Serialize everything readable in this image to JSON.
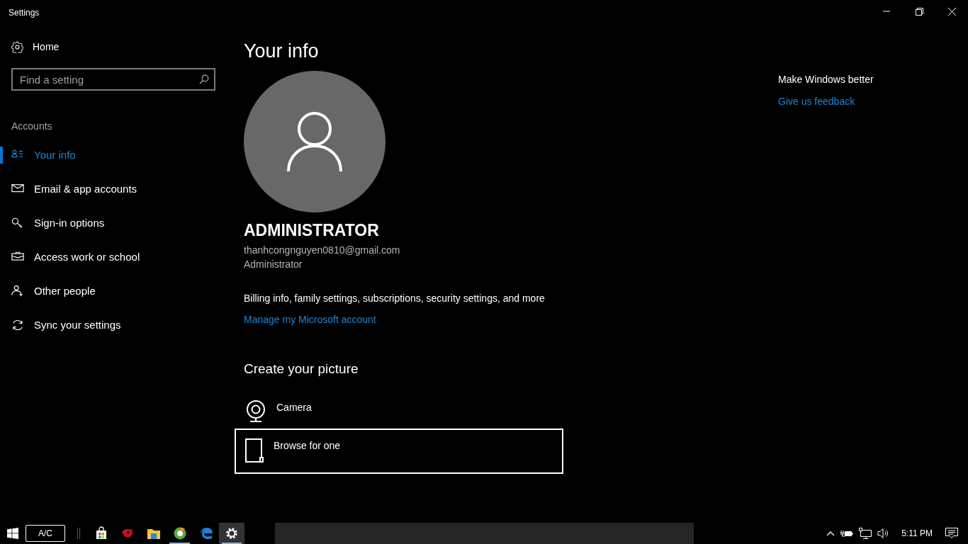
{
  "window": {
    "title": "Settings"
  },
  "sidebar": {
    "home": "Home",
    "search": {
      "placeholder": "Find a setting"
    },
    "section": "Accounts",
    "items": [
      {
        "label": "Your info",
        "selected": true
      },
      {
        "label": "Email & app accounts",
        "selected": false
      },
      {
        "label": "Sign-in options",
        "selected": false
      },
      {
        "label": "Access work or school",
        "selected": false
      },
      {
        "label": "Other people",
        "selected": false
      },
      {
        "label": "Sync your settings",
        "selected": false
      }
    ]
  },
  "main": {
    "title": "Your info",
    "name": "ADMINISTRATOR",
    "email": "thanhcongnguyen0810@gmail.com",
    "role": "Administrator",
    "description": "Billing info, family settings, subscriptions, security settings, and more",
    "link": "Manage my Microsoft account",
    "picture_heading": "Create your picture",
    "picture_options": [
      {
        "label": "Camera",
        "focused": false
      },
      {
        "label": "Browse for one",
        "focused": true
      }
    ]
  },
  "aside": {
    "heading": "Make Windows better",
    "link": "Give us feedback"
  },
  "taskbar": {
    "power_label": "A/C",
    "apps": [
      {
        "running": false,
        "selected": false
      },
      {
        "running": false,
        "selected": false
      },
      {
        "running": false,
        "selected": false
      },
      {
        "running": true,
        "selected": false
      },
      {
        "running": false,
        "selected": false
      },
      {
        "running": true,
        "selected": true
      }
    ],
    "clock": "5:11 PM"
  }
}
